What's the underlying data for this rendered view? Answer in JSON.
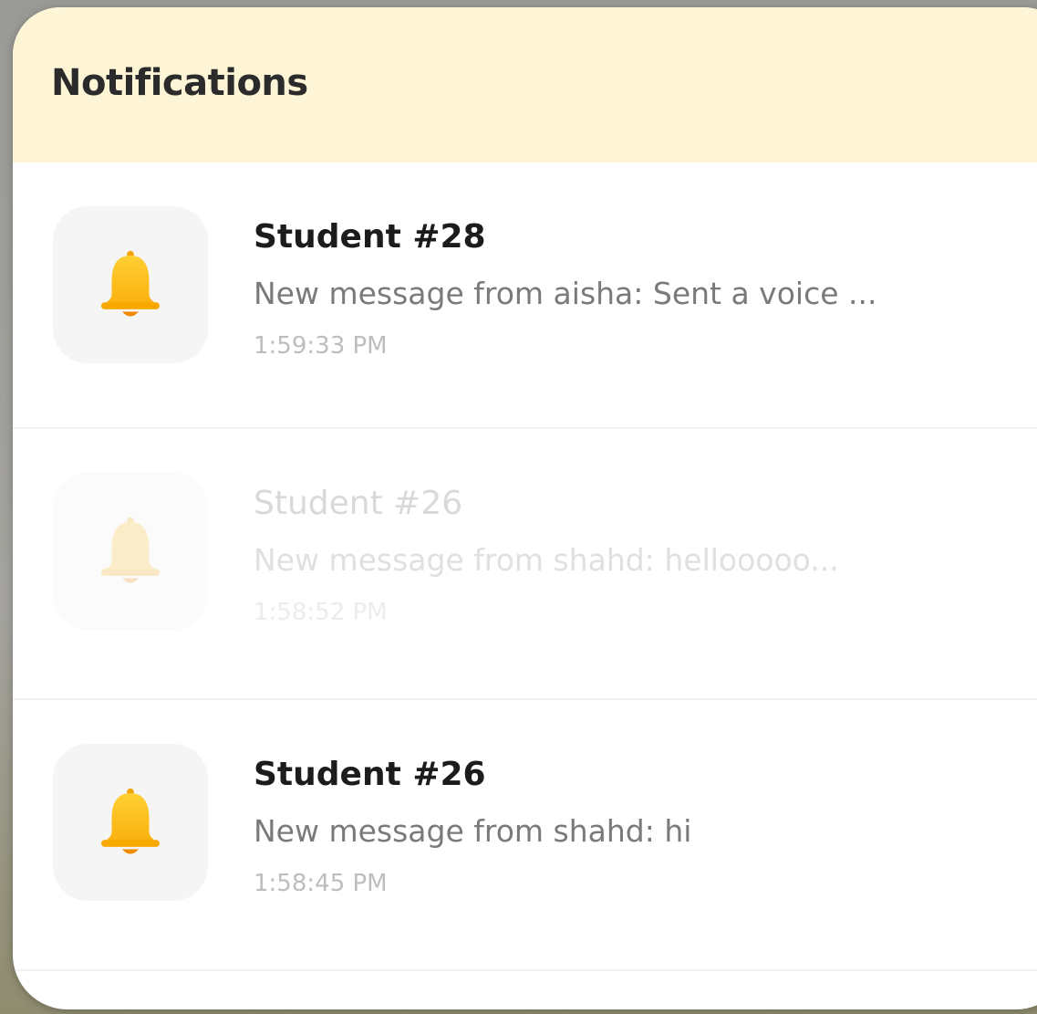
{
  "header": {
    "title": "Notifications"
  },
  "icon": "bell-icon",
  "colors": {
    "bell": "#FDBF1B",
    "header_bg": "#FDF5D6"
  },
  "notifications": [
    {
      "title": "Student #28",
      "message": "New message from aisha: Sent a voice ...",
      "time": "1:59:33 PM",
      "dimmed": false
    },
    {
      "title": "Student #26",
      "message": "New message from shahd: hellooooo...",
      "time": "1:58:52 PM",
      "dimmed": true
    },
    {
      "title": "Student #26",
      "message": "New message from shahd: hi",
      "time": "1:58:45 PM",
      "dimmed": false
    }
  ]
}
